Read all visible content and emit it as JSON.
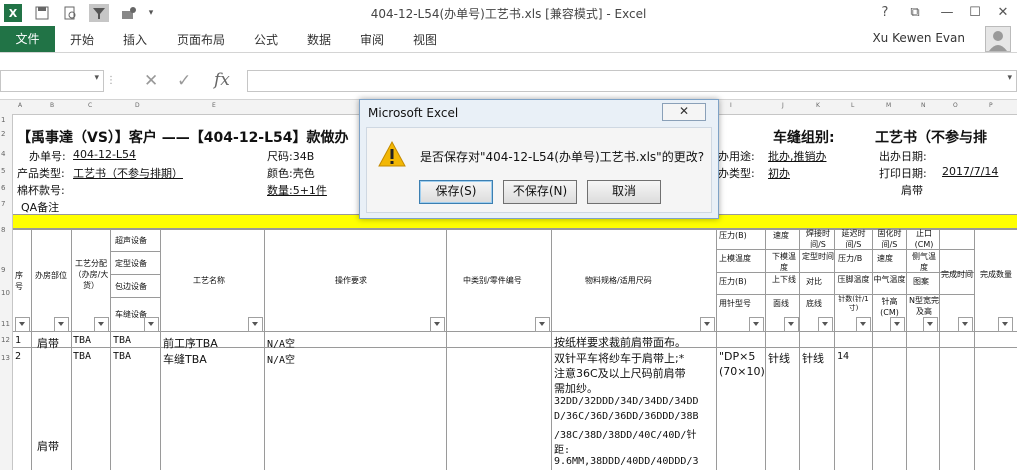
{
  "window": {
    "title": "404-12-L54(办单号)工艺书.xls  [兼容模式] - Excel",
    "help": "?",
    "restore_ribbon": "⧉",
    "minimize": "—",
    "maximize": "☐",
    "close": "✕"
  },
  "ribbon": {
    "file": "文件",
    "tabs": [
      "开始",
      "插入",
      "页面布局",
      "公式",
      "数据",
      "审阅",
      "视图"
    ],
    "user": "Xu Kewen Evan"
  },
  "formula_bar": {
    "name_box": "",
    "cancel": "✕",
    "enter": "✓",
    "fx": "fx",
    "formula": ""
  },
  "columns": [
    "A",
    "B",
    "C",
    "D",
    "E",
    "F",
    "G",
    "H",
    "I",
    "J",
    "K",
    "L",
    "M",
    "N",
    "O",
    "P"
  ],
  "rows": [
    "1",
    "2",
    "3",
    "4",
    "5",
    "6",
    "7",
    "8",
    "9",
    "10",
    "11",
    "12",
    "13",
    "14",
    "15",
    "16"
  ],
  "sheet": {
    "title": "【禹事達（VS）】客户 ——【404-12-L54】款做办",
    "group_label": "车缝组别:",
    "process_title": "工艺书（不参与排",
    "order_label": "办单号:",
    "order_value": "404-12-L54",
    "size_label": "尺码:34B",
    "purpose_label": "办用途:",
    "purpose_value": "批办,推销办",
    "out_date_label": "出办日期:",
    "type_label": "产品类型:",
    "type_value": "工艺书（不参与排期）",
    "color_label": "颜色:壳色",
    "sample_type_label": "办类型:",
    "sample_type_value": "初办",
    "print_date_label": "打印日期:",
    "print_date_value": "2017/7/14",
    "cup_label": "棉杯款号:",
    "qty_label": "数量:5+1件",
    "strap_label": "肩带",
    "qa_label": "QA备注",
    "headers": {
      "seq": "序号",
      "dept": "办房部位",
      "craft_alloc": "工艺分配（办房/大货）",
      "ultrasonic": "超声设备",
      "shaping": "定型设备",
      "edging": "包边设备",
      "sewing_eq": "车缝设备",
      "craft_name": "工艺名称",
      "op_req": "操作要求",
      "part_no": "中类别/零件编号",
      "material": "物料规格/适用尺码",
      "pressure_b": "压力(B)",
      "top_temp": "上模温度",
      "pressure_b2": "压力(B)",
      "needle": "用针型号",
      "speed": "速度",
      "lower_temp": "下模温度",
      "up_down_line": "上下线",
      "bottom_line": "面线",
      "weld_time": "焊接时间/S",
      "shape_time": "定型时间",
      "contrast": "对比",
      "bottom": "底线",
      "delay_time": "延迟时间/S",
      "pressure_b3": "压力/B",
      "foot_temp": "压脚温度",
      "stitch_count": "针数(针/1寸)",
      "fix_time": "固化时间/S",
      "speed2": "速度",
      "gas_temp": "中气温度",
      "stitch_height": "针高(CM)",
      "stop_cm": "止口(CM)",
      "side_temp": "侧气温度",
      "pattern": "图案",
      "n_shape": "N型宽完及高",
      "finish_time": "完成时间",
      "finish_qty": "完成数量"
    },
    "row1": {
      "seq": "1",
      "dept": "肩带",
      "alloc": "TBA",
      "equip": "TBA",
      "craft": "前工序TBA",
      "req": "N/A空",
      "material": "按纸样要求裁前肩带面布。"
    },
    "row2": {
      "seq": "2",
      "dept": "肩带",
      "alloc": "TBA",
      "equip": "TBA",
      "craft": "车缝TBA",
      "req": "N/A空",
      "material": [
        "双针平车将纱车于肩带上;*",
        "注意36C及以上尺码前肩带",
        "需加纱。",
        "32DD/32DDD/34D/34DD/34DD",
        "D/36C/36D/36DD/36DDD/38B",
        "/38C/38D/38DD/40C/40D/针",
        "距:",
        "9.6MM,38DDD/40DD/40DDD/3"
      ],
      "needle": "\"DP×5",
      "needle2": "(70×10)",
      "bottom": "针线",
      "bottom2": "针线",
      "stitch": "14"
    }
  },
  "dialog": {
    "title": "Microsoft Excel",
    "close": "✕",
    "message": "是否保存对\"404-12-L54(办单号)工艺书.xls\"的更改?",
    "save": "保存(S)",
    "dont_save": "不保存(N)",
    "cancel": "取消",
    "colors": {
      "border": "#7ea2c6",
      "warning": "#f2b705"
    }
  },
  "colors": {
    "excel_green": "#217346",
    "highlight_row": "#ffff00"
  }
}
